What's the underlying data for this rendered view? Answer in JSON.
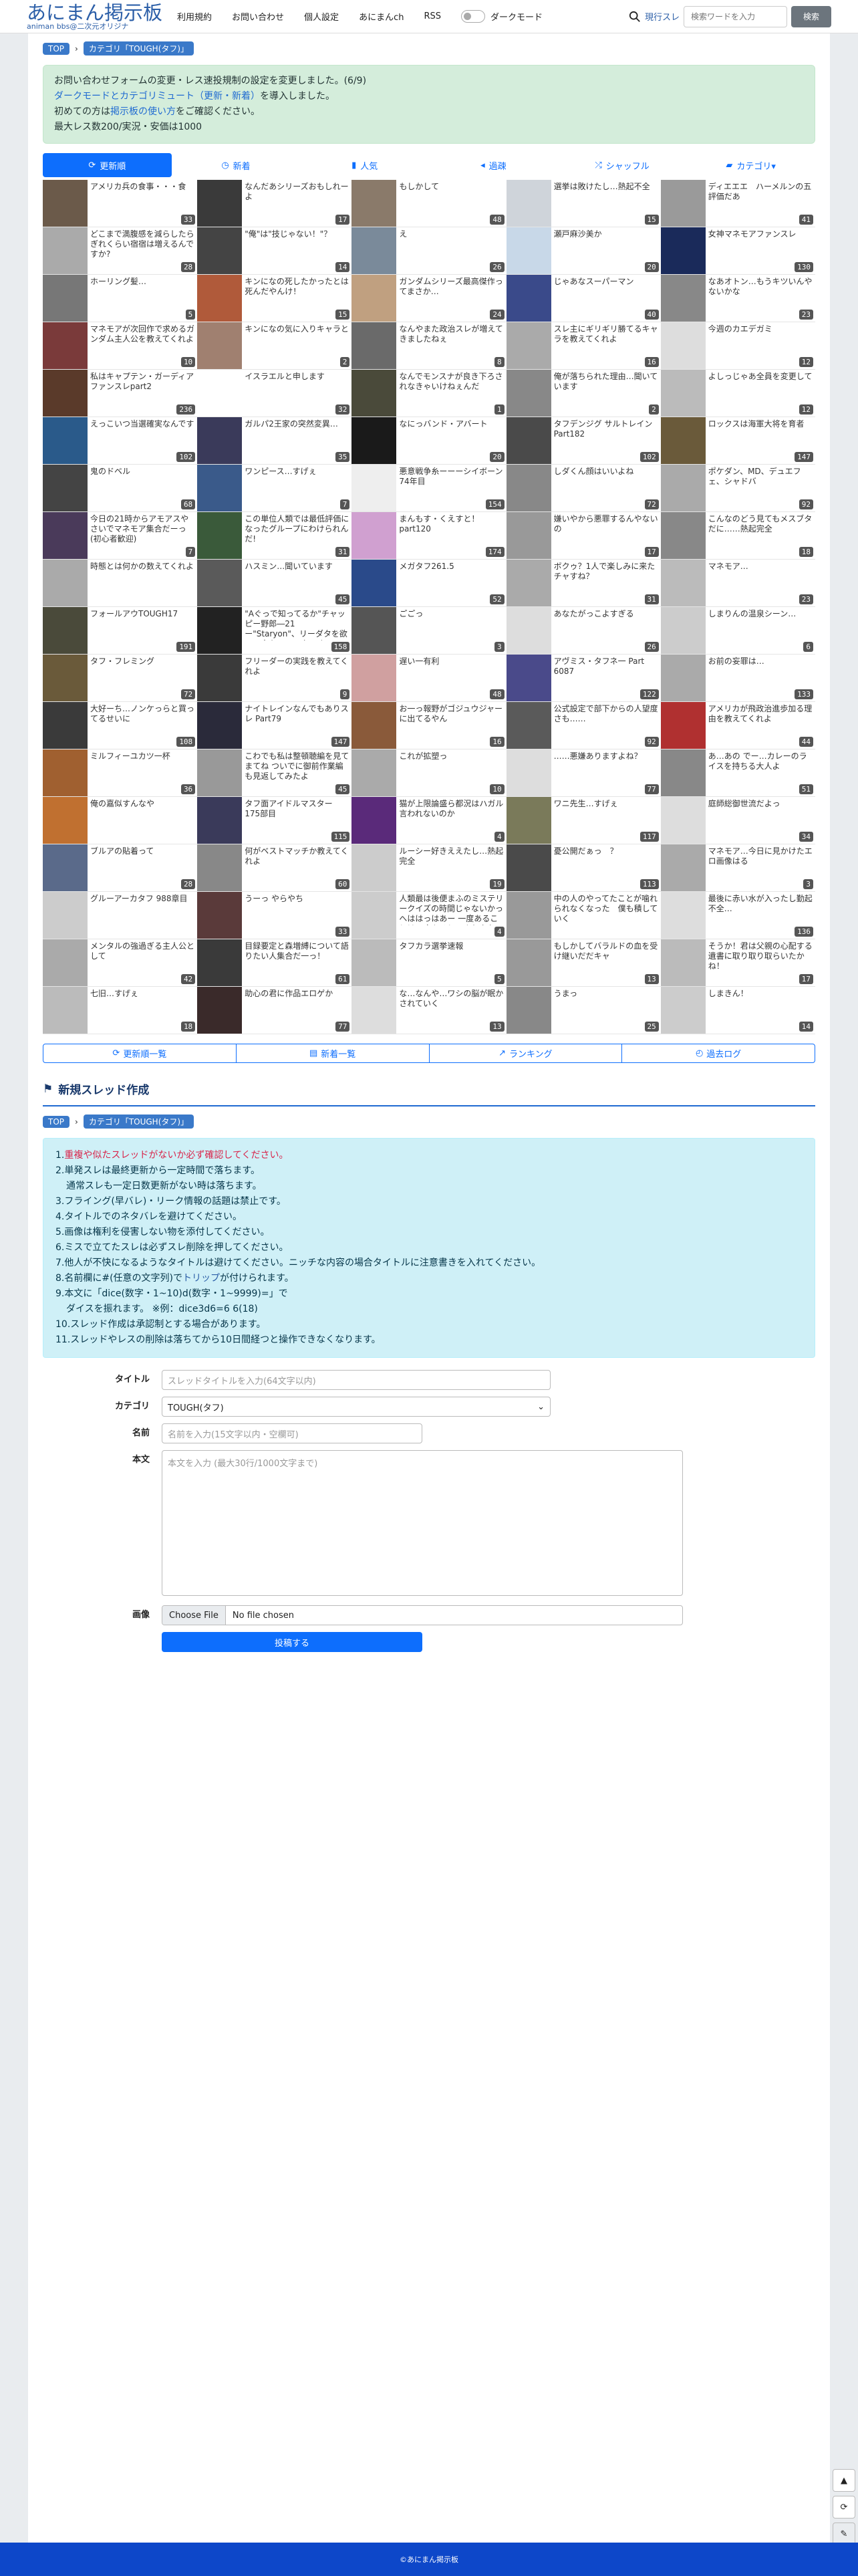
{
  "header": {
    "logo_title": "あにまん掲示板",
    "logo_sub": "animan bbs@二次元オリジナ",
    "nav": [
      "利用規約",
      "お問い合わせ",
      "個人設定",
      "あにまんch",
      "RSS"
    ],
    "darkmode": "ダークモード",
    "search_label": "現行スレ",
    "search_placeholder": "検索ワードを入力",
    "search_button": "検索"
  },
  "breadcrumb": {
    "top": "TOP",
    "category": "カテゴリ「TOUGH(タフ)」"
  },
  "notice": {
    "line1": "お問い合わせフォームの変更・レス速投規制の設定を変更しました。(6/9)",
    "line2_link": "ダークモードとカテゴリミュート（更新・新着）",
    "line2_rest": "を導入しました。",
    "line3_pre": "初めての方は",
    "line3_link": "掲示板の使い方",
    "line3_post": "をご確認ください。",
    "line4": "最大レス数200/実況・安価は1000"
  },
  "tabs": [
    "更新順",
    "新着",
    "人気",
    "過疎",
    "シャッフル",
    "カテゴリ▾"
  ],
  "threads": [
    {
      "t": "アメリカ兵の食事・・・食",
      "c": "33",
      "col": "#6b5a4a"
    },
    {
      "t": "なんだあシリーズおもしれーよ",
      "c": "17",
      "col": "#3a3a3a"
    },
    {
      "t": "もしかして",
      "c": "48",
      "col": "#8a7a6a"
    },
    {
      "t": "選挙は敗けたし…熱起不全",
      "c": "15",
      "col": "#cfd4da"
    },
    {
      "t": "ディエエエ　ハーメルンの五評価だあ",
      "c": "41",
      "col": "#9a9a9a"
    },
    {
      "t": "どこまで満腹感を減らしたらぎれくらい宿宿は増えるんですか?",
      "c": "28",
      "col": "#aaaaaa"
    },
    {
      "t": "\"俺\"は\"技じゃない！\"？",
      "c": "14",
      "col": "#444"
    },
    {
      "t": "え",
      "c": "26",
      "col": "#7a8a9a"
    },
    {
      "t": "瀬戸麻沙美か",
      "c": "20",
      "col": "#c8d8e8"
    },
    {
      "t": "女神マネモアファンスレ",
      "c": "130",
      "col": "#1a2a5a"
    },
    {
      "t": "ホーリング髪…",
      "c": "5",
      "col": "#777"
    },
    {
      "t": "キンになの死したかったとは死んだやんけ！",
      "c": "15",
      "col": "#b05a3a"
    },
    {
      "t": "ガンダムシリーズ最高傑作ってまさか…",
      "c": "24",
      "col": "#c0a080"
    },
    {
      "t": "じゃあなスーパーマン",
      "c": "40",
      "col": "#3a4a8a"
    },
    {
      "t": "なあオトン…もうキツいんやないかな",
      "c": "23",
      "col": "#888"
    },
    {
      "t": "マネモアが次回作で求めるガンダム主人公を教えてくれよ",
      "c": "10",
      "col": "#7a3a3a"
    },
    {
      "t": "キンになの気に入りキャラと",
      "c": "2",
      "col": "#a08070"
    },
    {
      "t": "なんやまた政治スレが増えてきましたねぇ",
      "c": "8",
      "col": "#6a6a6a"
    },
    {
      "t": "スレ主にギリギリ勝てるキャラを教えてくれよ",
      "c": "16",
      "col": "#aaa"
    },
    {
      "t": "今週のカエデガミ",
      "c": "12",
      "col": "#ddd"
    },
    {
      "t": "私はキャプテン・ガーディアファンスレpart2",
      "c": "236",
      "col": "#5a3a2a"
    },
    {
      "t": "イスラエルと申します",
      "c": "32",
      "col": "#ffffff"
    },
    {
      "t": "なんでモンスナが良き下ろされなきゃいけねぇんだ",
      "c": "1",
      "col": "#4a4a3a"
    },
    {
      "t": "俺が落ちられた理由…聞いています",
      "c": "2",
      "col": "#888"
    },
    {
      "t": "よしっじゃあ全員を変更して",
      "c": "12",
      "col": "#bbb"
    },
    {
      "t": "えっこいつ当選確実なんです",
      "c": "102",
      "col": "#2a5a8a"
    },
    {
      "t": "ガルパ2王家の突然変異…",
      "c": "35",
      "col": "#3a3a5a"
    },
    {
      "t": "なにっバンド・アバート",
      "c": "20",
      "col": "#1a1a1a"
    },
    {
      "t": "タフデンジグ サルトレイン Part182",
      "c": "102",
      "col": "#4a4a4a"
    },
    {
      "t": "ロックスは海軍大将を育者",
      "c": "147",
      "col": "#6a5a3a"
    },
    {
      "t": "鬼のドベル",
      "c": "68",
      "col": "#444"
    },
    {
      "t": "ワンピース…すげぇ",
      "c": "7",
      "col": "#3a5a8a"
    },
    {
      "t": "悪意戦争糸ーーーシイボーン 74年目",
      "c": "154",
      "col": "#eee"
    },
    {
      "t": "しダくん顔はいいよね",
      "c": "72",
      "col": "#888"
    },
    {
      "t": "ポケダン、MD、デュエフェ、シャドバ",
      "c": "92",
      "col": "#aaa"
    },
    {
      "t": "今日の21時からアモアスやさいでマネモア集合だーっ(初心者歓迎)",
      "c": "7",
      "col": "#4a3a5a"
    },
    {
      "t": "この単位人類では最低評価になったグループにわけられんだ!",
      "c": "31",
      "col": "#3a5a3a"
    },
    {
      "t": "まんもす・くえすと！part120",
      "c": "174",
      "col": "#d0a0d0"
    },
    {
      "t": "嫌いやから悪罪するんやないの",
      "c": "17",
      "col": "#999"
    },
    {
      "t": "こんなのどう見てもメスブタだに……熱起完全",
      "c": "18",
      "col": "#888"
    },
    {
      "t": "時態とは何かの数えてくれよ",
      "c": "",
      "col": "#aaa"
    },
    {
      "t": "ハスミン…聞いています",
      "c": "45",
      "col": "#5a5a5a"
    },
    {
      "t": "メガタフ261.5",
      "c": "52",
      "col": "#2a4a8a"
    },
    {
      "t": "ボクゥ？1人で楽しみに来たチャすね？",
      "c": "31",
      "col": "#aaa"
    },
    {
      "t": "マネモア…",
      "c": "23",
      "col": "#bbb"
    },
    {
      "t": "フォールアウTOUGH17",
      "c": "191",
      "col": "#4a4a3a"
    },
    {
      "t": "\"Aぐっで知ってるか\"チャッピー野郎―21ー\"Staryon\"、リーダタを欲のー安心フィルターオフ",
      "c": "158",
      "col": "#222"
    },
    {
      "t": "ごごっ",
      "c": "3",
      "col": "#555"
    },
    {
      "t": "あなたがっこよすぎる",
      "c": "26",
      "col": "#ddd"
    },
    {
      "t": "しまりんの温泉シーン…",
      "c": "6",
      "col": "#ccc"
    },
    {
      "t": "タフ・フレミング",
      "c": "72",
      "col": "#6a5a3a"
    },
    {
      "t": "フリーダーの実践を教えてくれよ",
      "c": "9",
      "col": "#3a3a3a"
    },
    {
      "t": "遅い一有利",
      "c": "48",
      "col": "#d0a0a0"
    },
    {
      "t": "アヴミス・タフネ一 Part 6087",
      "c": "122",
      "col": "#4a4a8a"
    },
    {
      "t": "お前の妄罪は…",
      "c": "133",
      "col": "#aaa"
    },
    {
      "t": "大好ーち…ノンケっらと買ってるせいに",
      "c": "108",
      "col": "#3a3a3a"
    },
    {
      "t": "ナイトレインなんでもありスレ Part79",
      "c": "147",
      "col": "#2a2a3a"
    },
    {
      "t": "お一っ報野がゴジュウジャーに出てるやん",
      "c": "16",
      "col": "#8a5a3a"
    },
    {
      "t": "公式設定で部下からの人望度さも……",
      "c": "92",
      "col": "#5a5a5a"
    },
    {
      "t": "アメリカが飛政治進歩加る理由を教えてくれよ",
      "c": "44",
      "col": "#b03030"
    },
    {
      "t": "ミルフィーユカツ一杯",
      "c": "36",
      "col": "#a06030"
    },
    {
      "t": "こわでも私は整頓聴編を見てまてね ついでに御前作業編も見返してみたよ",
      "c": "45",
      "col": "#999"
    },
    {
      "t": "これが拡塑っ",
      "c": "10",
      "col": "#aaa"
    },
    {
      "t": "……悪嫌ありますよね？",
      "c": "77",
      "col": "#ddd"
    },
    {
      "t": "あ…あの でー…カレーのライスを持ちる大人よ",
      "c": "51",
      "col": "#888"
    },
    {
      "t": "俺の嘉似すんなや",
      "c": "",
      "col": "#c07030"
    },
    {
      "t": "タフ面アイドルマスター 175部目",
      "c": "115",
      "col": "#3a3a5a"
    },
    {
      "t": "猫が上限論盛ら都況はハガル言われないのか",
      "c": "4",
      "col": "#5a2a7a"
    },
    {
      "t": "ワニ先生…すげぇ",
      "c": "117",
      "col": "#7a7a5a"
    },
    {
      "t": "庭師総御世流だよっ",
      "c": "34",
      "col": "#ddd"
    },
    {
      "t": "ブルアの貼着って",
      "c": "28",
      "col": "#5a6a8a"
    },
    {
      "t": "何がベストマッチか教えてくれよ",
      "c": "60",
      "col": "#888"
    },
    {
      "t": "ルーシー好きええたし…熱起完全",
      "c": "19",
      "col": "#ccc"
    },
    {
      "t": "憂公開だぁっ　？",
      "c": "113",
      "col": "#4a4a4a"
    },
    {
      "t": "マネモア…今日に見かけたエロ画像はる",
      "c": "3",
      "col": "#aaa"
    },
    {
      "t": "グルーアーカタフ 988章目",
      "c": "",
      "col": "#ccc"
    },
    {
      "t": "うーっ やらやち",
      "c": "33",
      "col": "#5a3a3a"
    },
    {
      "t": "人類最は後便まふのミステリークイズの時間じゃないかっ へははっはあー 一度あることは二度あるとでまれやないか一",
      "c": "4",
      "col": "#ccc"
    },
    {
      "t": "中の人のやってたことが噛れられなくなった　僕も積していく",
      "c": "",
      "col": "#999"
    },
    {
      "t": "最後に赤い水が入ったし勤起不全…",
      "c": "136",
      "col": "#ddd"
    },
    {
      "t": "メンタルの強過ぎる主人公として",
      "c": "42",
      "col": "#aaa"
    },
    {
      "t": "目録要定と森増縛について語りたい人集合だ一っ！",
      "c": "61",
      "col": "#3a3a3a"
    },
    {
      "t": "タフカラ選挙速報",
      "c": "5",
      "col": "#bbb"
    },
    {
      "t": "もしかしてバラルドの血を受け継いだだキャ",
      "c": "13",
      "col": "#999"
    },
    {
      "t": "そうか！君は父親の心配する遺書に取り取り取らいたかね！",
      "c": "17",
      "col": "#bbb"
    },
    {
      "t": "七旧…すげぇ",
      "c": "18",
      "col": "#bbb"
    },
    {
      "t": "助心の君に作品エロゲか",
      "c": "77",
      "col": "#3a2a2a"
    },
    {
      "t": "な…なんや…ワシの脳が眠かされていく",
      "c": "13",
      "col": "#ddd"
    },
    {
      "t": "うまっ",
      "c": "25",
      "col": "#888"
    },
    {
      "t": "しまきん！",
      "c": "14",
      "col": "#ccc"
    }
  ],
  "subnav": [
    "更新順一覧",
    "新着一覧",
    "ランキング",
    "過去ログ"
  ],
  "new_thread": {
    "heading": "新規スレッド作成",
    "rules": [
      {
        "n": "1.",
        "t": "重複や似たスレッドがないか必ず確認してください。",
        "cls": "red"
      },
      {
        "n": "2.",
        "t": "単発スレは最終更新から一定時間で落ちます。",
        "cls": ""
      },
      {
        "n": "",
        "t": "通常スレも一定日数更新がない時は落ちます。",
        "cls": ""
      },
      {
        "n": "3.",
        "t": "フライング(早バレ)・リーク情報の話題は禁止です。",
        "cls": ""
      },
      {
        "n": "4.",
        "t": "タイトルでのネタバレを避けてください。",
        "cls": ""
      },
      {
        "n": "5.",
        "t": "画像は権利を侵害しない物を添付してください。",
        "cls": ""
      },
      {
        "n": "6.",
        "t": "ミスで立てたスレは必ずスレ削除を押してください。",
        "cls": ""
      },
      {
        "n": "7.",
        "t": "他人が不快になるようなタイトルは避けてください。ニッチな内容の場合タイトルに注意書きを入れてください。",
        "cls": ""
      },
      {
        "n": "8.",
        "t": "名前欄に#(任意の文字列)で",
        "cls": "",
        "link": "トリップ",
        "post": "が付けられます。"
      },
      {
        "n": "9.",
        "t": "本文に「dice(数字・1~10)d(数字・1~9999)=」で",
        "cls": ""
      },
      {
        "n": "",
        "t": "ダイスを振れます。 ※例：dice3d6=6 6(18)",
        "cls": ""
      },
      {
        "n": "10.",
        "t": "スレッド作成は承認制とする場合があります。",
        "cls": ""
      },
      {
        "n": "11.",
        "t": "スレッドやレスの削除は落ちてから10日間経つと操作できなくなります。",
        "cls": ""
      }
    ],
    "title_label": "タイトル",
    "title_placeholder": "スレッドタイトルを入力(64文字以内)",
    "category_label": "カテゴリ",
    "category_value": "TOUGH(タフ)",
    "name_label": "名前",
    "name_placeholder": "名前を入力(15文字以内・空欄可)",
    "body_label": "本文",
    "body_placeholder": "本文を入力 (最大30行/1000文字まで)",
    "image_label": "画像",
    "choose_file": "Choose File",
    "no_file": "No file chosen",
    "submit": "投稿する"
  },
  "footer": "©あにまん掲示板"
}
